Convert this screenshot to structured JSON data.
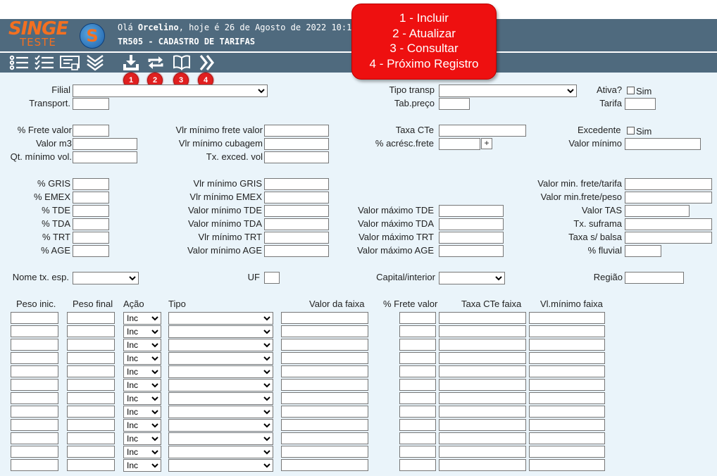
{
  "header": {
    "logo_top": "SINGE",
    "logo_bottom": "TESTE",
    "logo_badge": "S",
    "greeting_prefix": "Olá ",
    "user_name": "Orcelino",
    "greeting_suffix": ", hoje é 26 de Agosto de 2022 10:12h",
    "screen_title": "TR505 - CADASTRO DE TARIFAS"
  },
  "toolbar": {
    "left_icons": [
      "list-icon",
      "checklist-icon",
      "card-icon",
      "double-chevron-down-icon"
    ],
    "actions": [
      {
        "icon": "download-icon",
        "badge": "1"
      },
      {
        "icon": "refresh-icon",
        "badge": "2"
      },
      {
        "icon": "book-icon",
        "badge": "3"
      },
      {
        "icon": "double-chevron-right-icon",
        "badge": "4"
      }
    ]
  },
  "callout": {
    "lines": [
      "1 - Incluir",
      "2 - Atualizar",
      "3 - Consultar",
      "4 - Próximo Registro"
    ]
  },
  "form": {
    "filial": "Filial",
    "transport": "Transport.",
    "tipo_transp": "Tipo transp",
    "tab_preco": "Tab.preço",
    "ativa": "Ativa?",
    "ativa_sim": "Sim",
    "tarifa": "Tarifa",
    "pct_frete_valor": "% Frete valor",
    "valor_m3": "Valor m3",
    "qt_minimo_vol": "Qt. mínimo vol.",
    "vlr_min_frete_valor": "Vlr mínimo frete valor",
    "vlr_min_cubagem": "Vlr mínimo cubagem",
    "tx_exced_vol": "Tx. exced. vol",
    "taxa_cte": "Taxa CTe",
    "pct_acresc_frete": "% acrésc.frete",
    "plus": "+",
    "excedente": "Excedente",
    "excedente_sim": "Sim",
    "valor_minimo": "Valor mínimo",
    "pct_gris": "% GRIS",
    "pct_emex": "% EMEX",
    "pct_tde": "% TDE",
    "pct_tda": "% TDA",
    "pct_trt": "% TRT",
    "pct_age": "% AGE",
    "vlr_min_gris": "Vlr mínimo GRIS",
    "vlr_min_emex": "Vlr mínimo EMEX",
    "valor_min_tde": "Valor mínimo TDE",
    "valor_min_tda": "Valor mínimo TDA",
    "vlr_min_trt": "Vlr mínimo TRT",
    "valor_min_age": "Valor mínimo AGE",
    "valor_max_tde": "Valor máximo TDE",
    "valor_max_tda": "Valor máximo TDA",
    "valor_max_trt": "Valor máximo TRT",
    "valor_max_age": "Valor máximo AGE",
    "valor_min_frete_tarifa": "Valor min. frete/tarifa",
    "valor_min_frete_peso": "Valor min.frete/peso",
    "valor_tas": "Valor TAS",
    "tx_suframa": "Tx. suframa",
    "taxa_balsa": "Taxa s/ balsa",
    "pct_fluvial": "% fluvial",
    "nome_tx_esp": "Nome tx. esp.",
    "uf": "UF",
    "capital_interior": "Capital/interior",
    "regiao": "Região"
  },
  "grid": {
    "headers": {
      "peso_inic": "Peso inic.",
      "peso_final": "Peso final",
      "acao": "Ação",
      "tipo": "Tipo",
      "valor_faixa": "Valor da faixa",
      "pct_frete_valor": "% Frete valor",
      "taxa_cte_faixa": "Taxa CTe faixa",
      "vl_minimo_faixa": "Vl.mínimo faixa"
    },
    "row_count": 12,
    "acao_default": "Inc"
  }
}
